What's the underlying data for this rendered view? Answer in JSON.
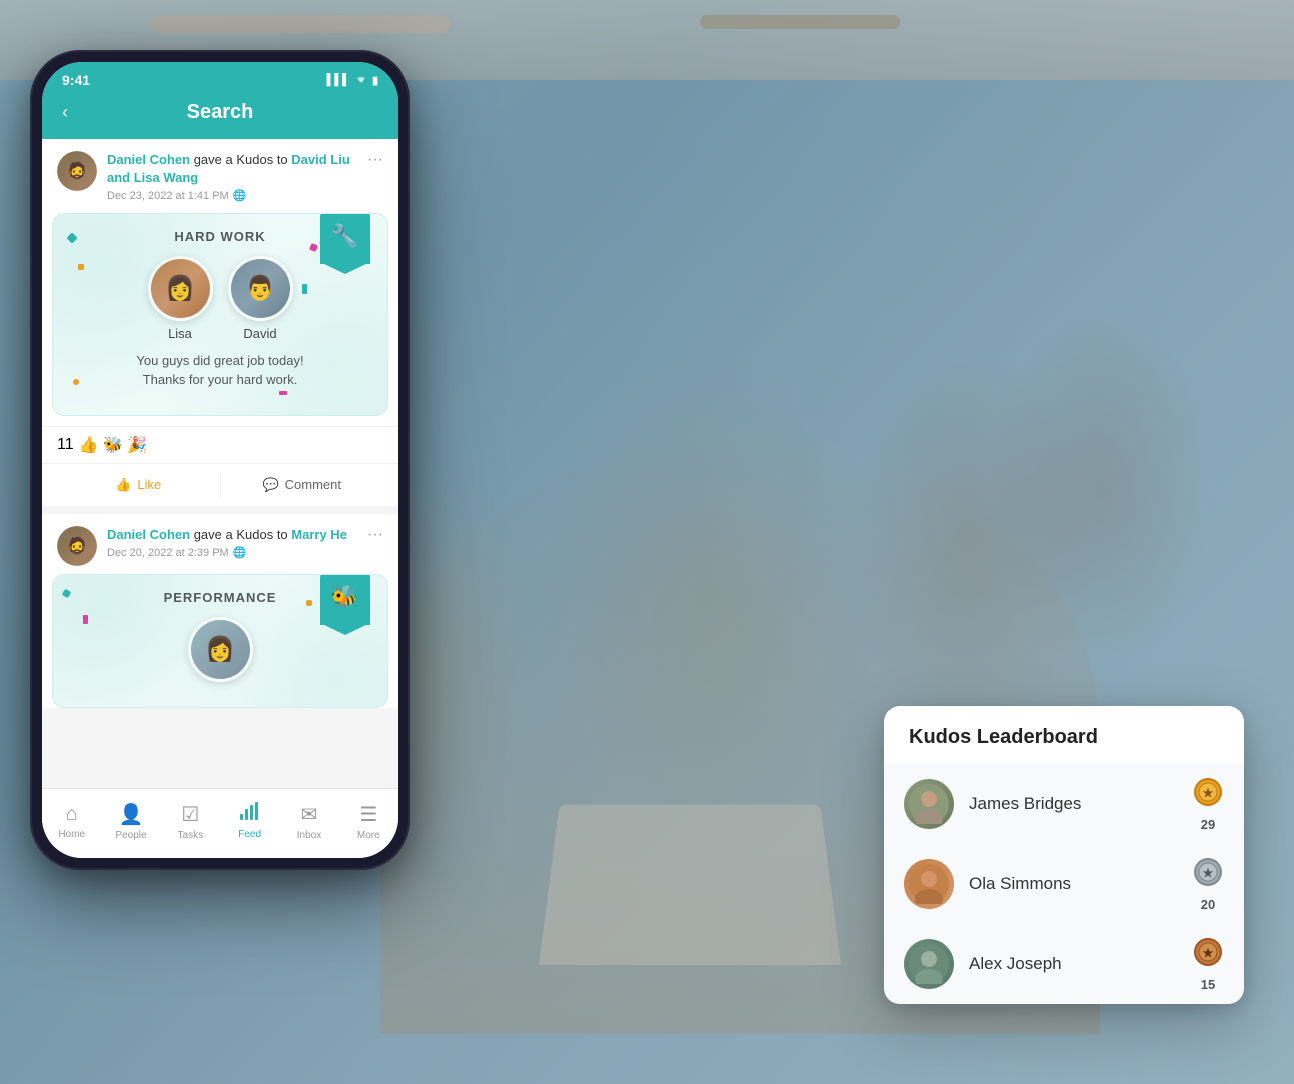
{
  "background": {
    "alt": "Group of people celebrating around a laptop"
  },
  "phone": {
    "status_bar": {
      "time": "9:41",
      "signal": "▌▌▌",
      "wifi": "WiFi",
      "battery": "🔋"
    },
    "header": {
      "back_label": "‹",
      "title": "Search"
    },
    "feed": {
      "items": [
        {
          "id": "feed-1",
          "actor": "Daniel Cohen",
          "action": "gave a Kudos to",
          "recipients": "David Liu and Lisa Wang",
          "date": "Dec 23, 2022 at 1:41 PM",
          "globe_icon": "🌐",
          "kudos_title": "HARD WORK",
          "badge_icon": "🔧",
          "persons": [
            {
              "name": "Lisa",
              "emoji": "👩"
            },
            {
              "name": "David",
              "emoji": "👨"
            }
          ],
          "message_line1": "You guys did great job today!",
          "message_line2": "Thanks for your hard work.",
          "reaction_count": "11",
          "reaction_emojis": "👍 🐝 🎉",
          "like_label": "Like",
          "comment_label": "Comment"
        },
        {
          "id": "feed-2",
          "actor": "Daniel Cohen",
          "action": "gave a Kudos to",
          "recipients": "Marry He",
          "date": "Dec 20, 2022 at 2:39 PM",
          "globe_icon": "🌐",
          "kudos_title": "PERFORMANCE",
          "badge_icon": "🐝"
        }
      ]
    },
    "bottom_nav": {
      "items": [
        {
          "label": "Home",
          "icon": "⌂",
          "active": false
        },
        {
          "label": "People",
          "icon": "👤",
          "active": false
        },
        {
          "label": "Tasks",
          "icon": "☑",
          "active": false
        },
        {
          "label": "Feed",
          "icon": "📶",
          "active": true
        },
        {
          "label": "Inbox",
          "icon": "✉",
          "active": false
        },
        {
          "label": "More",
          "icon": "☰",
          "active": false
        }
      ]
    }
  },
  "leaderboard": {
    "title": "Kudos Leaderboard",
    "entries": [
      {
        "rank": 1,
        "name": "James Bridges",
        "score": "29",
        "medal": "gold",
        "medal_icon": "🥇",
        "emoji": "👨"
      },
      {
        "rank": 2,
        "name": "Ola Simmons",
        "score": "20",
        "medal": "silver",
        "medal_icon": "🥈",
        "emoji": "👩"
      },
      {
        "rank": 3,
        "name": "Alex Joseph",
        "score": "15",
        "medal": "bronze",
        "medal_icon": "🥉",
        "emoji": "👨"
      }
    ]
  },
  "colors": {
    "teal": "#2cb5b0",
    "gold": "#e8a020",
    "silver": "#a0a8b0",
    "bronze": "#c07840",
    "bg_gray": "#f8f9fa"
  }
}
